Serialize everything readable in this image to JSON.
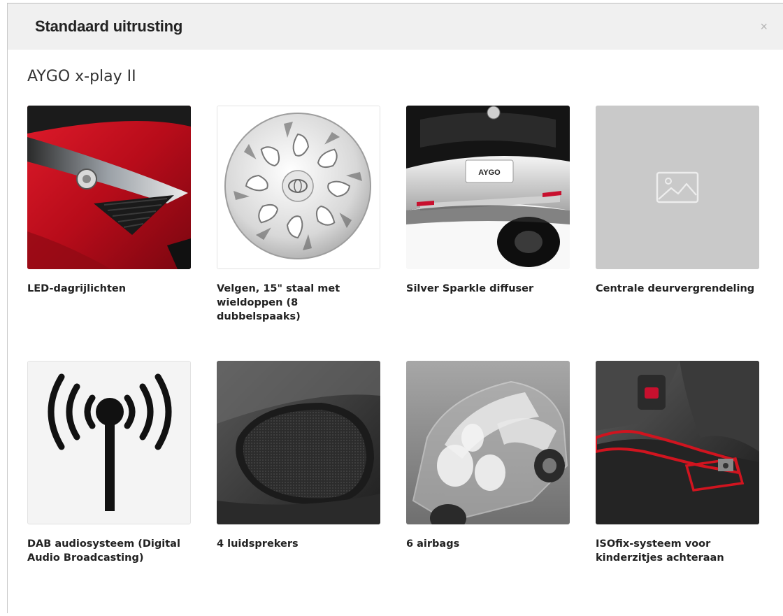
{
  "modal": {
    "title": "Standaard uitrusting",
    "close_label": "×",
    "model_name": "AYGO x-play II"
  },
  "features": [
    {
      "label": "LED-dagrijlichten",
      "image": "led-headlight-photo"
    },
    {
      "label": "Velgen, 15\" staal met wieldoppen (8 dubbelspaaks)",
      "image": "hubcap-photo"
    },
    {
      "label": "Silver Sparkle diffuser",
      "image": "rear-diffuser-photo",
      "badge_text": "AYGO"
    },
    {
      "label": "Centrale deurvergrendeling",
      "image": "image-placeholder-icon"
    },
    {
      "label": "DAB audiosysteem (Digital Audio Broadcasting)",
      "image": "antenna-signal-icon"
    },
    {
      "label": "4 luidsprekers",
      "image": "speaker-grille-photo"
    },
    {
      "label": "6 airbags",
      "image": "airbags-xray-photo"
    },
    {
      "label": "ISOfix-systeem voor kinderzitjes achteraan",
      "image": "isofix-seat-photo"
    }
  ],
  "colors": {
    "header_bg": "#f0f0f0",
    "accent_red": "#c8102e",
    "placeholder_bg": "#c9c9c9"
  }
}
